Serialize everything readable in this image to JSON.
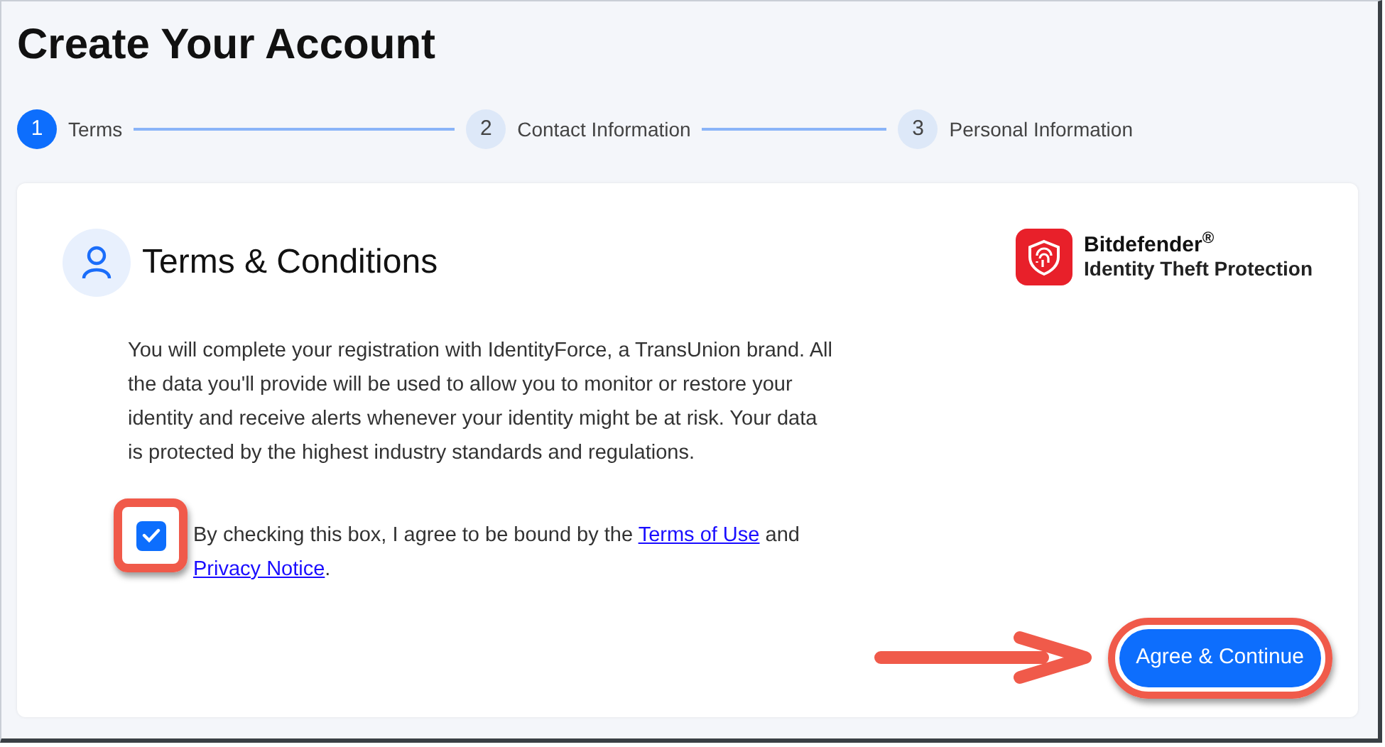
{
  "page_title": "Create Your Account",
  "steps": [
    {
      "number": "1",
      "label": "Terms",
      "selected": true
    },
    {
      "number": "2",
      "label": "Contact Information",
      "selected": false
    },
    {
      "number": "3",
      "label": "Personal Information",
      "selected": false
    }
  ],
  "card": {
    "heading": "Terms & Conditions",
    "logo": {
      "brand": "Bitdefender$^{®}$",
      "product": "Identity Theft Protection"
    },
    "body": "You will complete your registration with IdentityForce, a TransUnion brand. All the data you'll provide will be used to allow you to monitor or restore your identity and receive alerts whenever your identity might be at risk. Your data is protected by the highest industry standards and regulations.",
    "consent": {
      "checked": true,
      "highlighted": true,
      "text_before": "By checking this box, I agree to be bound by the",
      "terms_link": "Terms of Use",
      "text_middle": "and",
      "privacy_link": "Privacy Notice",
      "text_after": "."
    },
    "button": {
      "label": "Agree & Continue",
      "highlighted": true,
      "pointer_arrow": true
    }
  }
}
